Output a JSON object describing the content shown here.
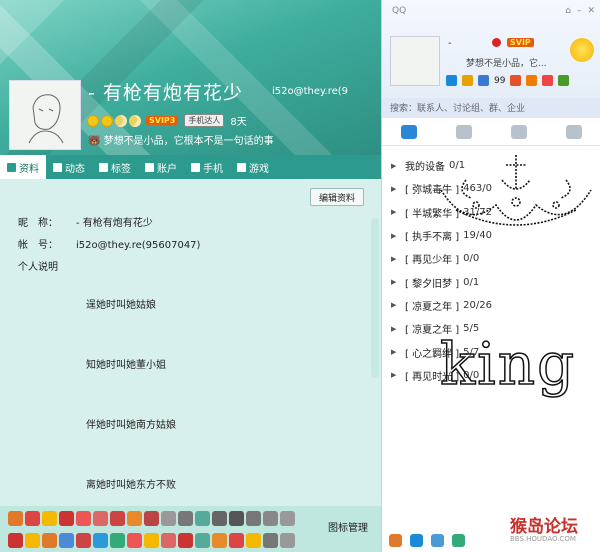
{
  "profile": {
    "nickname": "-  有枪有炮有花少",
    "account": "i52o@they.re(9",
    "days": "8天",
    "svip": "SVIP3",
    "mobile": "手机达人",
    "signature": "梦想不是小品，它根本不是一句话的事",
    "tabs": [
      "资料",
      "动态",
      "标签",
      "账户",
      "手机",
      "游戏"
    ],
    "edit_label": "编辑资料",
    "fields": [
      {
        "label": "昵　称：",
        "value": "-   有枪有炮有花少"
      },
      {
        "label": "帐　号：",
        "value": "i52o@they.re(95607047)"
      },
      {
        "label": "个人说明",
        "value": ""
      }
    ],
    "story": [
      "逞她时叫她姑娘",
      "知她时叫她董小姐",
      "伴她时叫她南方姑娘",
      "离她时叫她东方不败"
    ],
    "icon_manager": "图标管理",
    "colors": {
      "header": "#3fae9e",
      "tabbar": "#2c9a8c",
      "body": "#d8f0eb"
    }
  },
  "qq": {
    "logo": "QQ",
    "nickname": "-",
    "svip": "SVIP",
    "signature": "梦想不是小品，它...",
    "mail_count": "99",
    "search_placeholder": "搜索：联系人、讨论组、群、企业",
    "groups": [
      {
        "name": "我的设备",
        "count": "0/1"
      },
      {
        "name": "[ 弥城毒牛 ]",
        "count": "463/0"
      },
      {
        "name": "[ 半城繁华 ]",
        "count": "31/72"
      },
      {
        "name": "[ 执手不离 ]",
        "count": "19/40"
      },
      {
        "name": "[ 再见少年 ]",
        "count": "0/0"
      },
      {
        "name": "[ 黎夕旧梦 ]",
        "count": "0/1"
      },
      {
        "name": "[ 凉夏之年 ]",
        "count": "20/26"
      },
      {
        "name": "[ 凉夏之年 ]",
        "count": "5/5"
      },
      {
        "name": "[ 心之羁绊 ]",
        "count": "5/7"
      },
      {
        "name": "[ 再见时光 ]",
        "count": "0/0"
      }
    ],
    "overlay_text": "king",
    "watermark": "猴岛论坛",
    "watermark_url": "BBS.HOUDAO.COM"
  }
}
